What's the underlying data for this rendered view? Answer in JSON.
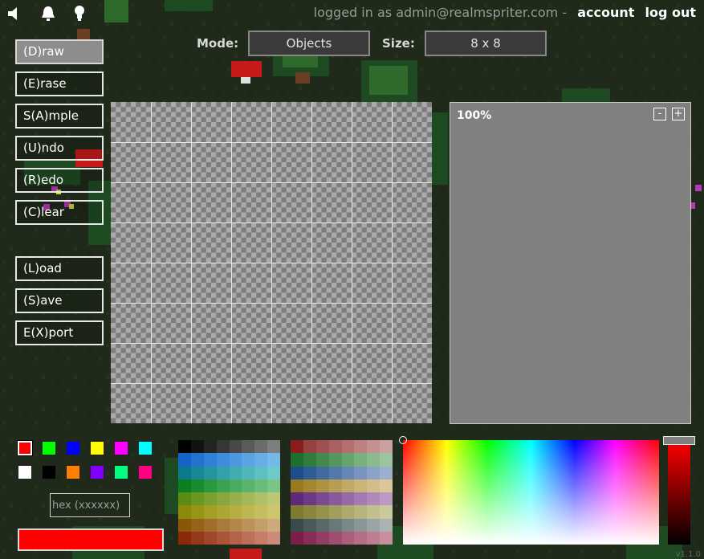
{
  "header": {
    "logged_in_text": "logged in as admin@realmspriter.com -",
    "account_link": "account",
    "logout_link": "log out",
    "icons": [
      "speaker-icon",
      "bell-icon",
      "lightbulb-icon"
    ]
  },
  "tools": [
    {
      "label": "(D)raw",
      "active": true
    },
    {
      "label": "(E)rase"
    },
    {
      "label": "S(A)mple"
    },
    {
      "label": "(U)ndo"
    },
    {
      "label": "(R)edo"
    },
    {
      "label": "(C)lear"
    },
    {
      "label": "(L)oad"
    },
    {
      "label": "(S)ave"
    },
    {
      "label": "E(X)port"
    }
  ],
  "mode": {
    "label": "Mode:",
    "value": "Objects"
  },
  "size": {
    "label": "Size:",
    "value": "8 x 8"
  },
  "canvas": {
    "grid_cells": 8
  },
  "preview": {
    "zoom": "100%",
    "zoom_out": "-",
    "zoom_in": "+"
  },
  "swatches": [
    "#ff0000",
    "#00ff00",
    "#0000ff",
    "#ffff00",
    "#ff00ff",
    "#00ffff",
    "#ffffff",
    "#000000",
    "#ff8000",
    "#8000ff",
    "#00ff80",
    "#ff0080"
  ],
  "selected_swatch": 0,
  "hex": {
    "placeholder": "hex (xxxxxx)"
  },
  "current_color": "#ff0000",
  "palette_gray_cool": {
    "columns": 8,
    "rows": [
      [
        "#000000",
        "#121212",
        "#242424",
        "#363636",
        "#484848",
        "#5a5a5a",
        "#6c6c6c",
        "#7e7e7e"
      ],
      [
        "#1463c8",
        "#2272d0",
        "#3080d8",
        "#3e8ddc",
        "#4c99e0",
        "#5aa4e4",
        "#68aee6",
        "#76b8ea"
      ],
      [
        "#0a7a8c",
        "#188796",
        "#2694a0",
        "#34a0aa",
        "#42acb2",
        "#50b6ba",
        "#5ec0c2",
        "#6ccaca"
      ],
      [
        "#0a8020",
        "#1a8c30",
        "#2a9840",
        "#3aa250",
        "#4aac5e",
        "#5ab46c",
        "#6abc7a",
        "#7ac488"
      ],
      [
        "#5a8c14",
        "#6a9622",
        "#7aa030",
        "#88a83e",
        "#96b04c",
        "#a4b85a",
        "#b0c068",
        "#bcc876"
      ],
      [
        "#8c8a0a",
        "#989418",
        "#a29e26",
        "#aca634",
        "#b6ae42",
        "#beb650",
        "#c6be5e",
        "#cec66c"
      ],
      [
        "#8a560a",
        "#96621a",
        "#a06e2a",
        "#aa7a3a",
        "#b4864a",
        "#bc925a",
        "#c49e6a",
        "#ccaa7a"
      ],
      [
        "#8a2a0a",
        "#96381a",
        "#a0462a",
        "#aa543a",
        "#b4624a",
        "#bc705a",
        "#c47e6a",
        "#cc8c7a"
      ]
    ]
  },
  "palette_muted": {
    "columns": 8,
    "rows": [
      [
        "#8a1e1e",
        "#964040",
        "#a05050",
        "#aa6060",
        "#b47070",
        "#bc8080",
        "#c49090",
        "#cca0a0"
      ],
      [
        "#1e6e2e",
        "#307c3e",
        "#428a4e",
        "#54985e",
        "#66a66e",
        "#78b07e",
        "#8aba8e",
        "#9cc49e"
      ],
      [
        "#1e4e8a",
        "#305c96",
        "#426aa0",
        "#5478aa",
        "#6686b4",
        "#7894bc",
        "#8aa2c4",
        "#9cb0cc"
      ],
      [
        "#9a7a1e",
        "#a48630",
        "#ae9242",
        "#b89e54",
        "#c2aa66",
        "#caB478",
        "#d2be8a",
        "#dac89c"
      ],
      [
        "#5e2a7a",
        "#6c3a86",
        "#7a4a92",
        "#885a9e",
        "#966aa8",
        "#a47ab2",
        "#b08aba",
        "#bc9ac4"
      ],
      [
        "#7e7a2e",
        "#8a863e",
        "#96924e",
        "#a29e5e",
        "#aeaa6e",
        "#b8b47e",
        "#c2be8e",
        "#ccc89e"
      ],
      [
        "#3a4a4a",
        "#4a5858",
        "#5a6868",
        "#6a7878",
        "#7a8888",
        "#8a9696",
        "#9aa4a4",
        "#aab2b2"
      ],
      [
        "#7a1e4a",
        "#862e56",
        "#923e62",
        "#9e4e6e",
        "#aa5e7a",
        "#b46e86",
        "#be7e92",
        "#c88e9e"
      ]
    ]
  },
  "version": "v1.1.0"
}
